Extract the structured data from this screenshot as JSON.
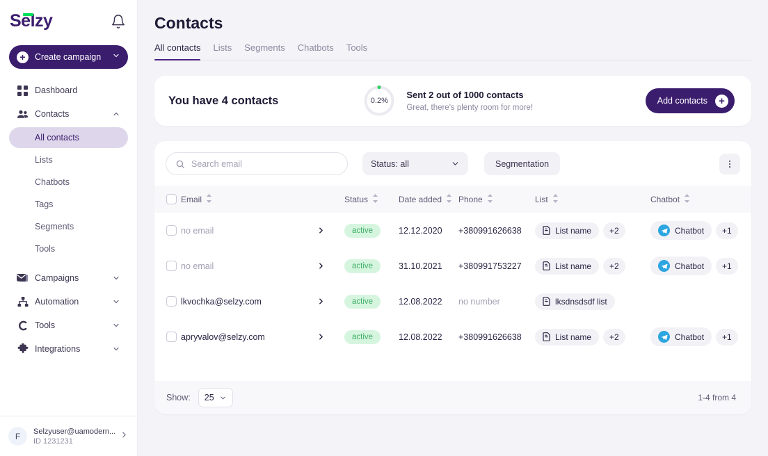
{
  "brand": {
    "name": "Selzy",
    "accent_purple": "#3b1d6e",
    "accent_green": "#00e05a",
    "tab_underline": "#4b2180",
    "bg": "#f4f3f7"
  },
  "sidebar": {
    "notification_icon": "bell-icon",
    "create_campaign": {
      "label": "Create campaign",
      "plus_icon": "plus-circle-icon",
      "chevron_icon": "chevron-down-icon"
    },
    "nav": [
      {
        "label": "Dashboard",
        "icon": "grid-icon",
        "expandable": false,
        "active": false
      },
      {
        "label": "Contacts",
        "icon": "people-icon",
        "expandable": true,
        "chevron": "chevron-up-icon",
        "active": false
      }
    ],
    "contacts_subnav": [
      {
        "label": "All contacts",
        "active": true
      },
      {
        "label": "Lists",
        "active": false
      },
      {
        "label": "Chatbots",
        "active": false
      },
      {
        "label": "Tags",
        "active": false
      },
      {
        "label": "Segments",
        "active": false
      },
      {
        "label": "Tools",
        "active": false
      }
    ],
    "nav_bottom": [
      {
        "label": "Campaigns",
        "icon": "envelope-icon",
        "chevron": "chevron-down-icon"
      },
      {
        "label": "Automation",
        "icon": "sitemap-icon",
        "chevron": "chevron-down-icon"
      },
      {
        "label": "Tools",
        "icon": "wrench-c-icon",
        "chevron": "chevron-down-icon"
      },
      {
        "label": "Integrations",
        "icon": "puzzle-icon",
        "chevron": "chevron-down-icon"
      }
    ],
    "user": {
      "avatar_initial": "F",
      "email": "Selzyuser@uamodern...",
      "id": "ID 1231231",
      "chevron": "chevron-right-icon"
    }
  },
  "header": {
    "title": "Contacts",
    "tabs": [
      {
        "label": "All contacts",
        "active": true
      },
      {
        "label": "Lists",
        "active": false
      },
      {
        "label": "Segments",
        "active": false
      },
      {
        "label": "Chatbots",
        "active": false
      },
      {
        "label": "Tools",
        "active": false
      }
    ]
  },
  "banner": {
    "title": "You have 4 contacts",
    "ring_percent_label": "0.2%",
    "ring_percent_value": 0.2,
    "line1": "Sent 2 out of 1000 contacts",
    "line2": "Great, there's plenty room for more!",
    "add_button": {
      "label": "Add contacts",
      "icon": "plus-circle-icon"
    }
  },
  "toolbar": {
    "search_placeholder": "Search email",
    "search_value": "",
    "search_icon": "search-icon",
    "status_filter": {
      "label": "Status: all",
      "chevron": "chevron-down-icon"
    },
    "segmentation_label": "Segmentation",
    "more_icon": "kebab-menu-icon"
  },
  "table": {
    "columns": [
      {
        "label": "Email",
        "sortable": true
      },
      {
        "label": "Status",
        "sortable": true
      },
      {
        "label": "Date added",
        "sortable": true
      },
      {
        "label": "Phone",
        "sortable": true
      },
      {
        "label": "List",
        "sortable": true
      },
      {
        "label": "Chatbot",
        "sortable": true
      }
    ],
    "rows": [
      {
        "email": "no email",
        "email_muted": true,
        "selected": false,
        "status": "active",
        "date": "12.12.2020",
        "phone": "+380991626638",
        "phone_muted": false,
        "list": {
          "name": "List name",
          "icon": "list-doc-icon",
          "more": "+2"
        },
        "chatbot": {
          "name": "Chatbot",
          "icon": "telegram-icon",
          "more": "+1"
        }
      },
      {
        "email": "no email",
        "email_muted": true,
        "selected": false,
        "status": "active",
        "date": "31.10.2021",
        "phone": "+380991753227",
        "phone_muted": false,
        "list": {
          "name": "List name",
          "icon": "list-doc-icon",
          "more": "+2"
        },
        "chatbot": {
          "name": "Chatbot",
          "icon": "telegram-icon",
          "more": "+1"
        }
      },
      {
        "email": "lkvochka@selzy.com",
        "email_muted": false,
        "selected": false,
        "status": "active",
        "date": "12.08.2022",
        "phone": "no number",
        "phone_muted": true,
        "list": {
          "name": "lksdnsdsdf list",
          "icon": "list-doc-icon",
          "more": ""
        },
        "chatbot": {
          "name": "",
          "icon": "",
          "more": ""
        }
      },
      {
        "email": "apryvalov@selzy.com",
        "email_muted": false,
        "selected": false,
        "status": "active",
        "date": "12.08.2022",
        "phone": "+380991626638",
        "phone_muted": false,
        "list": {
          "name": "List name",
          "icon": "list-doc-icon",
          "more": "+2"
        },
        "chatbot": {
          "name": "Chatbot",
          "icon": "telegram-icon",
          "more": "+1"
        }
      }
    ]
  },
  "footer": {
    "show_label": "Show:",
    "page_size": "25",
    "page_size_chevron": "chevron-down-icon",
    "range": "1-4 from 4"
  }
}
